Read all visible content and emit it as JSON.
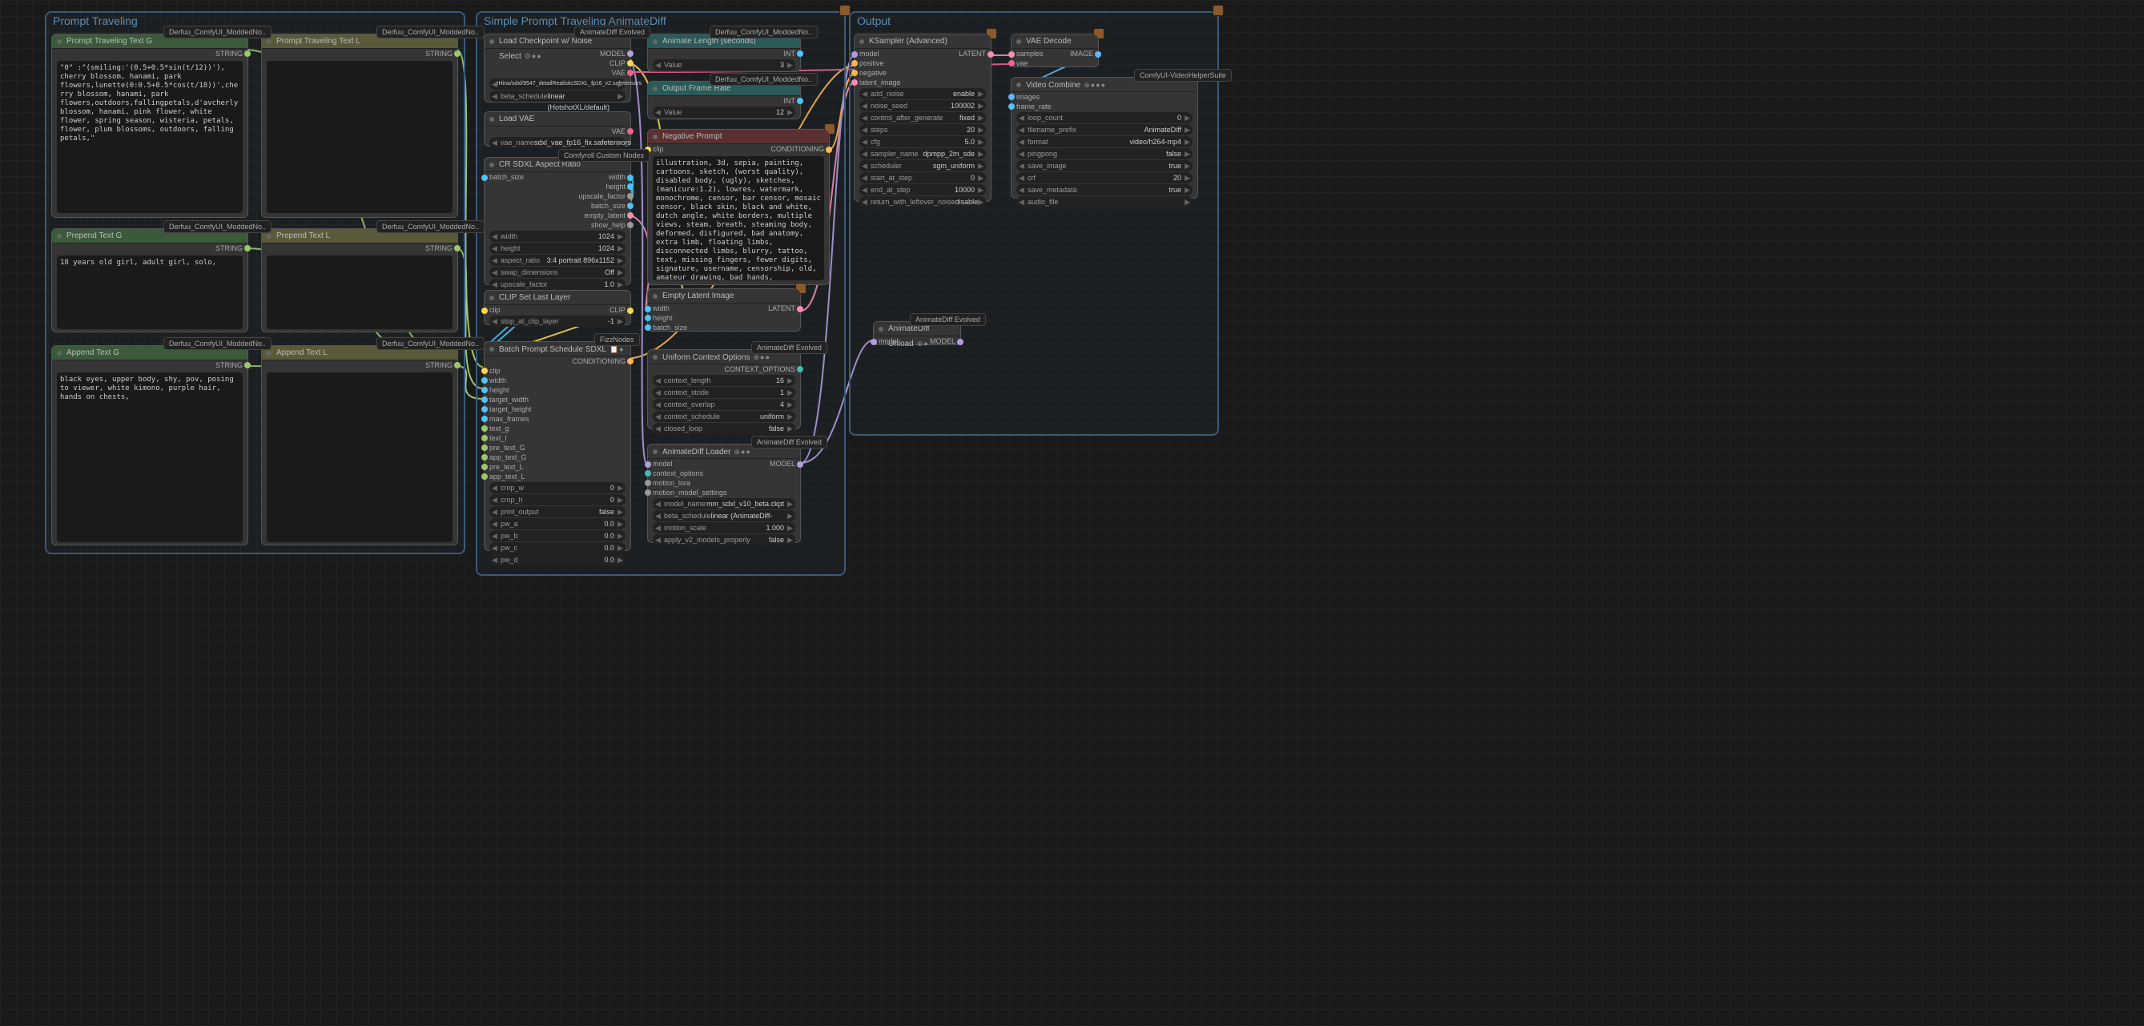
{
  "groups": {
    "pt": "Prompt Traveling",
    "sp": "Simple Prompt Traveling AnimateDiff",
    "out": "Output"
  },
  "badges": {
    "derfuu": "Derfuu_ComfyUI_ModdedNo..",
    "comfyroll": "Comfyroll Custom Nodes",
    "fizz": "FizzNodes",
    "ad_evolved": "AnimateDiff Evolved",
    "vhs": "ComfyUI-VideoHelperSuite"
  },
  "nodes": {
    "ptg": {
      "title": "Prompt Traveling Text G",
      "out": "STRING",
      "text": "\"0\" :\"(smiling:'(0.5+0.5*sin(t/12))'), cherry blossom, hanami, park flowers,lunette(0:0.5+0.5*cos(t/18))',cherry blossom, hanami, park flowers,outdoors,fallingpetals,d'avcherly blossom, hanami, pink flower, white flower, spring season, wisteria, petals, flower, plum blossoms, outdoors, falling petals,\""
    },
    "ptl": {
      "title": "Prompt Traveling Text L",
      "out": "STRING",
      "text": ""
    },
    "preg": {
      "title": "Prepend Text G",
      "out": "STRING",
      "text": "18 years old girl, adult girl, solo,"
    },
    "prel": {
      "title": "Prepend Text L",
      "out": "STRING",
      "text": ""
    },
    "appg": {
      "title": "Append Text G",
      "out": "STRING",
      "text": "black eyes, upper body, shy, pov, posing to viewer, white kimono, purple hair, hands on chests,"
    },
    "appl": {
      "title": "Append Text L",
      "out": "STRING",
      "text": ""
    },
    "ckpt": {
      "title": "Load Checkpoint w/ Noise Select",
      "outs": [
        "MODEL",
        "CLIP",
        "VAE"
      ],
      "w1": {
        "l": "",
        "v": "zHina/sdxl/9547_detailRealisticSDXL_fp16_v2.safetensors"
      },
      "w2": {
        "l": "beta_schedule",
        "v": "linear (HotshotXL/default)"
      }
    },
    "vae": {
      "title": "Load VAE",
      "outs": [
        "VAE"
      ],
      "w1": {
        "l": "vae_name",
        "v": "sdxl_vae_fp16_fix.safetensors"
      }
    },
    "ar": {
      "title": "CR SDXL Aspect Ratio",
      "ins": [
        "batch_size"
      ],
      "outs": [
        "width",
        "height",
        "upscale_factor",
        "batch_size",
        "empty_latent",
        "show_help"
      ],
      "w": [
        {
          "l": "width",
          "v": "1024"
        },
        {
          "l": "height",
          "v": "1024"
        },
        {
          "l": "aspect_ratio",
          "v": "3:4 portrait 896x1152"
        },
        {
          "l": "swap_dimensions",
          "v": "Off"
        },
        {
          "l": "upscale_factor",
          "v": "1.0"
        }
      ]
    },
    "csl": {
      "title": "CLIP Set Last Layer",
      "ins": [
        "clip"
      ],
      "outs": [
        "CLIP"
      ],
      "w1": {
        "l": "stop_at_clip_layer",
        "v": "-1"
      }
    },
    "bps": {
      "title": "Batch Prompt Schedule SDXL",
      "outs": [
        "CONDITIONING"
      ],
      "ins": [
        "clip",
        "width",
        "height",
        "target_width",
        "target_height",
        "max_frames",
        "text_g",
        "text_l",
        "pre_text_G",
        "app_text_G",
        "pre_text_L",
        "app_text_L"
      ],
      "w": [
        {
          "l": "crop_w",
          "v": "0"
        },
        {
          "l": "crop_h",
          "v": "0"
        },
        {
          "l": "print_output",
          "v": "false"
        },
        {
          "l": "pw_a",
          "v": "0.0"
        },
        {
          "l": "pw_b",
          "v": "0.0"
        },
        {
          "l": "pw_c",
          "v": "0.0"
        },
        {
          "l": "pw_d",
          "v": "0.0"
        }
      ]
    },
    "alen": {
      "title": "Animate Length (seconds)",
      "outs": [
        "INT"
      ],
      "w1": {
        "l": "Value",
        "v": "3"
      }
    },
    "ofr": {
      "title": "Output Frame Rate",
      "outs": [
        "INT"
      ],
      "w1": {
        "l": "Value",
        "v": "12"
      }
    },
    "neg": {
      "title": "Negative Prompt",
      "ins": [
        "clip"
      ],
      "outs": [
        "CONDITIONING"
      ],
      "text": "illustration, 3d, sepia, painting, cartoons, sketch, (worst quality), disabled body, (ugly), sketches, (manicure:1.2), lowres, watermark, monochrome, censor, bar censor, mosaic censor, black skin, black and white, dutch angle, white borders, multiple views, steam, breath, steaming body, deformed, disfigured, bad anatomy, extra limb, floating limbs, disconnected limbs, blurry, tattoo, text, missing fingers, fewer digits, signature, username, censorship, old, amateur drawing, bad hands,"
    },
    "eli": {
      "title": "Empty Latent Image",
      "ins": [
        "width",
        "height",
        "batch_size"
      ],
      "outs": [
        "LATENT"
      ]
    },
    "uco": {
      "title": "Uniform Context Options",
      "outs": [
        "CONTEXT_OPTIONS"
      ],
      "w": [
        {
          "l": "context_length",
          "v": "16"
        },
        {
          "l": "context_stride",
          "v": "1"
        },
        {
          "l": "context_overlap",
          "v": "4"
        },
        {
          "l": "context_schedule",
          "v": "uniform"
        },
        {
          "l": "closed_loop",
          "v": "false"
        }
      ]
    },
    "adl": {
      "title": "AnimateDiff Loader",
      "ins": [
        "model",
        "context_options",
        "motion_lora",
        "motion_model_settings"
      ],
      "outs": [
        "MODEL"
      ],
      "w": [
        {
          "l": "model_name",
          "v": "mm_sdxl_v10_beta.ckpt"
        },
        {
          "l": "beta_schedule",
          "v": "linear (AnimateDiff-SDXL)"
        },
        {
          "l": "motion_scale",
          "v": "1.000"
        },
        {
          "l": "apply_v2_models_properly",
          "v": "false"
        }
      ]
    },
    "ks": {
      "title": "KSampler (Advanced)",
      "ins": [
        "model",
        "positive",
        "negative",
        "latent_image"
      ],
      "outs": [
        "LATENT"
      ],
      "w": [
        {
          "l": "add_noise",
          "v": "enable"
        },
        {
          "l": "noise_seed",
          "v": "100002"
        },
        {
          "l": "control_after_generate",
          "v": "fixed"
        },
        {
          "l": "steps",
          "v": "20"
        },
        {
          "l": "cfg",
          "v": "5.0"
        },
        {
          "l": "sampler_name",
          "v": "dpmpp_2m_sde"
        },
        {
          "l": "scheduler",
          "v": "sgm_uniform"
        },
        {
          "l": "start_at_step",
          "v": "0"
        },
        {
          "l": "end_at_step",
          "v": "10000"
        },
        {
          "l": "return_with_leftover_noise",
          "v": "disable"
        }
      ]
    },
    "vd": {
      "title": "VAE Decode",
      "ins": [
        "samples",
        "vae"
      ],
      "outs": [
        "IMAGE"
      ]
    },
    "vc": {
      "title": "Video Combine",
      "ins": [
        "images",
        "frame_rate"
      ],
      "w": [
        {
          "l": "loop_count",
          "v": "0"
        },
        {
          "l": "filename_prefix",
          "v": "AnimateDiff"
        },
        {
          "l": "format",
          "v": "video/h264-mp4"
        },
        {
          "l": "pingpong",
          "v": "false"
        },
        {
          "l": "save_image",
          "v": "true"
        },
        {
          "l": "crf",
          "v": "20"
        },
        {
          "l": "save_metadata",
          "v": "true"
        },
        {
          "l": "audio_file",
          "v": ""
        }
      ]
    },
    "adu": {
      "title": "AnimateDiff Unload",
      "ins": [
        "model"
      ],
      "outs": [
        "MODEL"
      ]
    }
  }
}
